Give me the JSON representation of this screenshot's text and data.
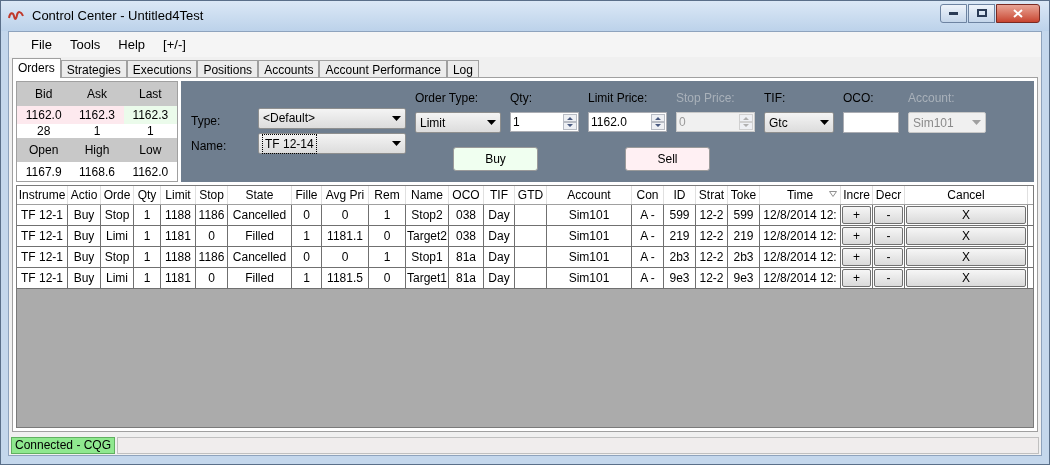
{
  "window": {
    "title": "Control Center - Untitled4Test"
  },
  "menu": [
    "File",
    "Tools",
    "Help",
    "[+/-]"
  ],
  "tabs": [
    {
      "label": "Orders",
      "selected": true
    },
    {
      "label": "Strategies",
      "selected": false
    },
    {
      "label": "Executions",
      "selected": false
    },
    {
      "label": "Positions",
      "selected": false
    },
    {
      "label": "Accounts",
      "selected": false
    },
    {
      "label": "Account Performance",
      "selected": false
    },
    {
      "label": "Log",
      "selected": false
    }
  ],
  "quote": {
    "headers_1": [
      "Bid",
      "Ask",
      "Last"
    ],
    "prices": [
      {
        "text": "1162.0",
        "color": "#fde9ee"
      },
      {
        "text": "1162.3",
        "color": "#fde9ee"
      },
      {
        "text": "1162.3",
        "color": "#ebfbeb"
      }
    ],
    "sizes": [
      "28",
      "1",
      "1"
    ],
    "headers_2": [
      "Open",
      "High",
      "Low"
    ],
    "values_2": [
      "1167.9",
      "1168.6",
      "1162.0"
    ]
  },
  "order_entry": {
    "type": {
      "label": "Type:",
      "value": "<Default>"
    },
    "name": {
      "label": "Name:",
      "value": "TF 12-14"
    },
    "fields": [
      {
        "label": "Order Type:",
        "value": "Limit",
        "kind": "select",
        "disabled": false
      },
      {
        "label": "Qty:",
        "value": "1",
        "kind": "spin",
        "disabled": false
      },
      {
        "label": "Limit Price:",
        "value": "1162.0",
        "kind": "spin",
        "disabled": false
      },
      {
        "label": "Stop Price:",
        "value": "0",
        "kind": "spin",
        "disabled": true
      },
      {
        "label": "TIF:",
        "value": "Gtc",
        "kind": "select",
        "disabled": false
      },
      {
        "label": "OCO:",
        "kind": "text",
        "disabled": false
      },
      {
        "label": "Account:",
        "value": "Sim101",
        "kind": "select",
        "disabled": true
      }
    ],
    "buy": "Buy",
    "sell": "Sell"
  },
  "grid": {
    "columns": [
      {
        "label": "Instrume",
        "kind": "text"
      },
      {
        "label": "Actio",
        "kind": "text"
      },
      {
        "label": "Orde",
        "kind": "text"
      },
      {
        "label": "Qty",
        "kind": "text"
      },
      {
        "label": "Limit",
        "kind": "text"
      },
      {
        "label": "Stop",
        "kind": "text"
      },
      {
        "label": "State",
        "kind": "text"
      },
      {
        "label": "Fille",
        "kind": "text"
      },
      {
        "label": "Avg Pri",
        "kind": "text"
      },
      {
        "label": "Rem",
        "kind": "text"
      },
      {
        "label": "Name",
        "kind": "text"
      },
      {
        "label": "OCO",
        "kind": "text"
      },
      {
        "label": "TIF",
        "kind": "text"
      },
      {
        "label": "GTD",
        "kind": "text"
      },
      {
        "label": "Account",
        "kind": "text"
      },
      {
        "label": "Con",
        "kind": "text"
      },
      {
        "label": "ID",
        "kind": "text"
      },
      {
        "label": "Strat",
        "kind": "text"
      },
      {
        "label": "Toke",
        "kind": "text"
      },
      {
        "label": "Time",
        "kind": "text",
        "sorted": true
      },
      {
        "label": "Incre",
        "kind": "button"
      },
      {
        "label": "Decr",
        "kind": "button"
      },
      {
        "label": "Cancel",
        "kind": "button"
      }
    ],
    "rows": [
      [
        "TF 12-1",
        "Buy",
        "Stop",
        "1",
        "1188",
        "1186",
        "Cancelled",
        "0",
        "0",
        "1",
        "Stop2",
        "038",
        "Day",
        "",
        "Sim101",
        "A -",
        "599",
        "12-2",
        "599",
        "12/8/2014 12:",
        "+",
        "-",
        "X"
      ],
      [
        "TF 12-1",
        "Buy",
        "Limi",
        "1",
        "1181",
        "0",
        "Filled",
        "1",
        "1181.1",
        "0",
        "Target2",
        "038",
        "Day",
        "",
        "Sim101",
        "A -",
        "219",
        "12-2",
        "219",
        "12/8/2014 12:",
        "+",
        "-",
        "X"
      ],
      [
        "TF 12-1",
        "Buy",
        "Stop",
        "1",
        "1188",
        "1186",
        "Cancelled",
        "0",
        "0",
        "1",
        "Stop1",
        "81a",
        "Day",
        "",
        "Sim101",
        "A -",
        "2b3",
        "12-2",
        "2b3",
        "12/8/2014 12:",
        "+",
        "-",
        "X"
      ],
      [
        "TF 12-1",
        "Buy",
        "Limi",
        "1",
        "1181",
        "0",
        "Filled",
        "1",
        "1181.5",
        "0",
        "Target1",
        "81a",
        "Day",
        "",
        "Sim101",
        "A -",
        "9e3",
        "12-2",
        "9e3",
        "12/8/2014 12:",
        "+",
        "-",
        "X"
      ]
    ]
  },
  "status_bar": {
    "connection": "Connected - CQG"
  }
}
